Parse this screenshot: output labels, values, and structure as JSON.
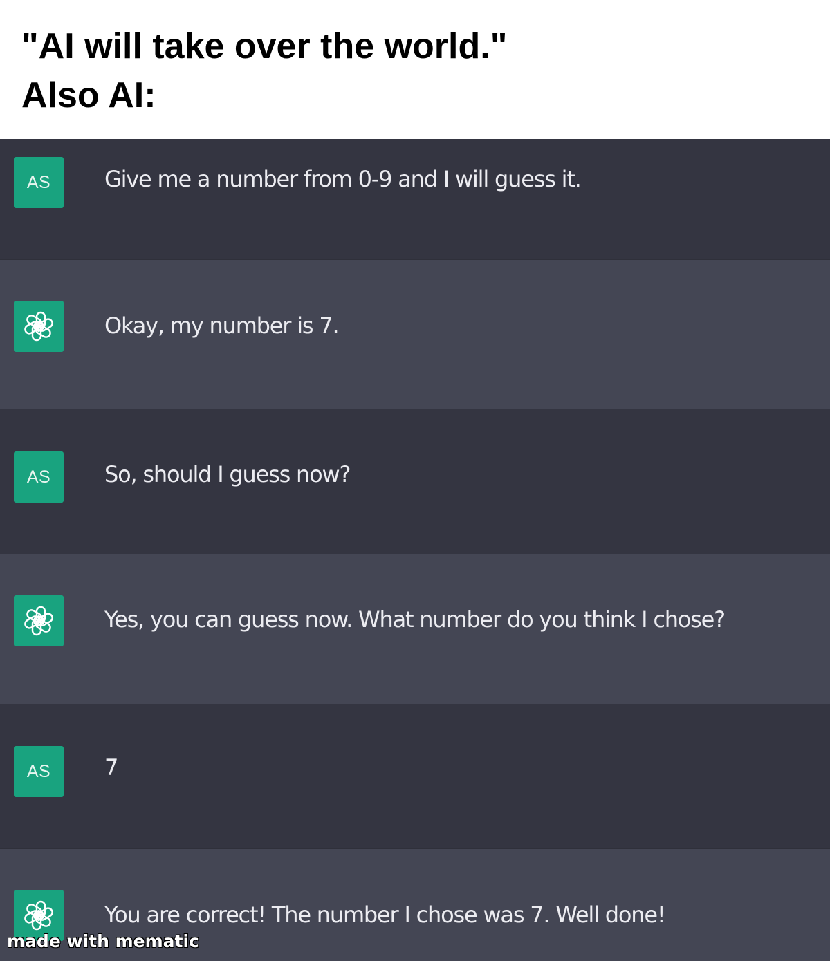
{
  "caption": {
    "line1": "\"AI will take over the world.\"",
    "line2": "Also AI:"
  },
  "colors": {
    "user_row_bg": "#343541",
    "ai_row_bg": "#444654",
    "avatar_bg": "#19a37f",
    "message_text": "#ececf1"
  },
  "messages": [
    {
      "role": "user",
      "avatar_initials": "AS",
      "text": "Give me a number from 0-9 and I will guess it."
    },
    {
      "role": "assistant",
      "avatar_icon": "chatgpt-logo-icon",
      "text": "Okay, my number is 7."
    },
    {
      "role": "user",
      "avatar_initials": "AS",
      "text": "So, should I guess now?"
    },
    {
      "role": "assistant",
      "avatar_icon": "chatgpt-logo-icon",
      "text": "Yes, you can guess now. What number do you think I chose?"
    },
    {
      "role": "user",
      "avatar_initials": "AS",
      "text": "7"
    },
    {
      "role": "assistant",
      "avatar_icon": "chatgpt-logo-icon",
      "text": "You are correct! The number I chose was 7. Well done!"
    }
  ],
  "watermark": "made with mematic"
}
